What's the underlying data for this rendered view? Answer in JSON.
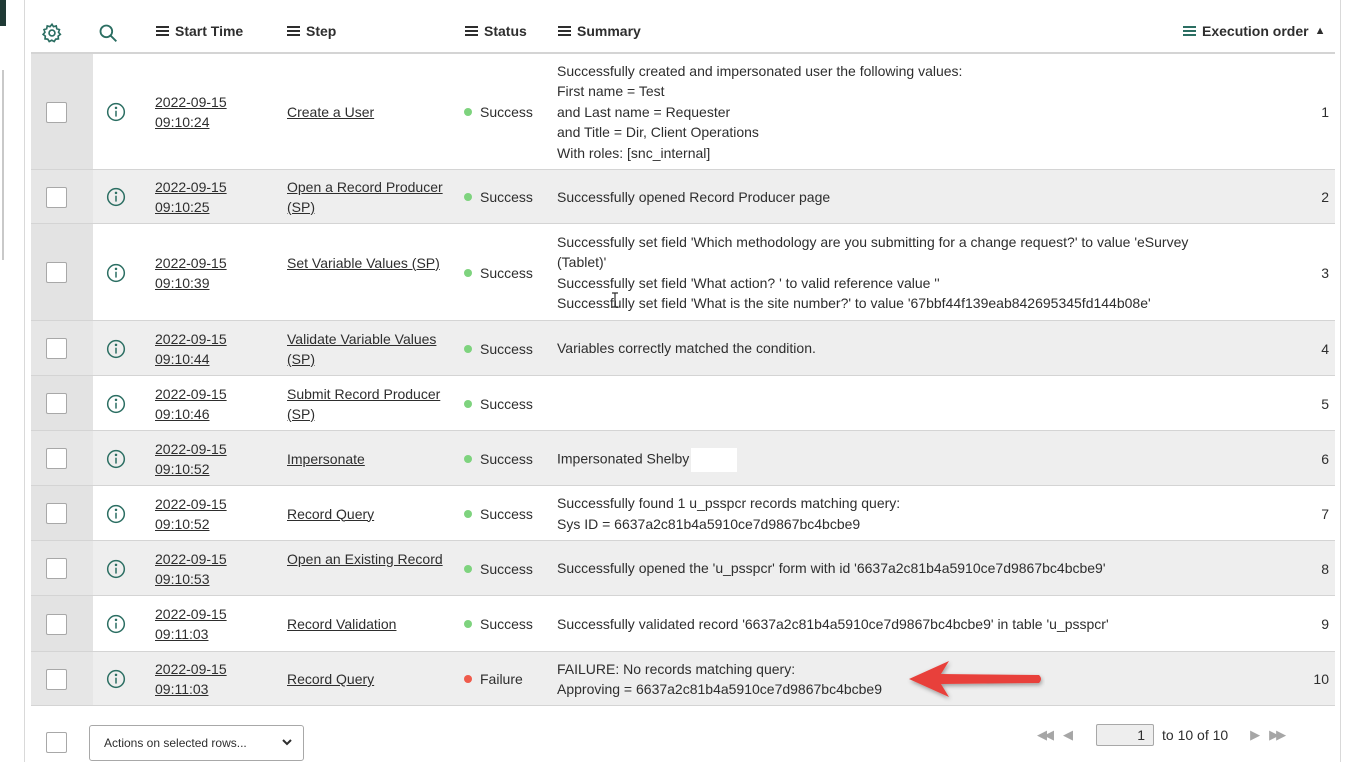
{
  "header": {
    "start_time": "Start Time",
    "step": "Step",
    "status": "Status",
    "summary": "Summary",
    "execution_order": "Execution order",
    "sort_indicator": "▲"
  },
  "icons": {
    "settings": "gear-icon",
    "search": "search-icon",
    "column_menu": "hamburger-icon",
    "row_info": "info-icon",
    "annotation": "red-arrow"
  },
  "colors": {
    "accent": "#2b6e62",
    "success": "#7ed37e",
    "failure": "#ef5b4b",
    "arrow": "#e8413a"
  },
  "rows": [
    {
      "date": "2022-09-15",
      "time": "09:10:24",
      "step": "Create a User",
      "status": "Success",
      "status_type": "ok",
      "summary": [
        "Successfully created and impersonated user the following values:",
        "First name = Test",
        "and Last name = Requester",
        "and Title = Dir, Client Operations",
        "With roles: [snc_internal]"
      ],
      "order": "1"
    },
    {
      "date": "2022-09-15",
      "time": "09:10:25",
      "step": "Open a Record Producer (SP)",
      "status": "Success",
      "status_type": "ok",
      "summary": [
        "Successfully opened Record Producer page"
      ],
      "order": "2"
    },
    {
      "date": "2022-09-15",
      "time": "09:10:39",
      "step": "Set Variable Values (SP)",
      "status": "Success",
      "status_type": "ok",
      "summary": [
        "Successfully set field 'Which methodology are you submitting for a change request?' to value 'eSurvey (Tablet)'",
        "Successfully set field 'What action? ' to valid reference value ''",
        "Successfully set field 'What is the site number?' to value '67bbf44f139eab842695345fd144b08e'"
      ],
      "order": "3"
    },
    {
      "date": "2022-09-15",
      "time": "09:10:44",
      "step": "Validate Variable Values (SP)",
      "status": "Success",
      "status_type": "ok",
      "summary": [
        "Variables correctly matched the condition."
      ],
      "order": "4"
    },
    {
      "date": "2022-09-15",
      "time": "09:10:46",
      "step": "Submit Record Producer (SP)",
      "status": "Success",
      "status_type": "ok",
      "summary": [],
      "order": "5"
    },
    {
      "date": "2022-09-15",
      "time": "09:10:52",
      "step": "Impersonate",
      "status": "Success",
      "status_type": "ok",
      "summary": [
        "Impersonated Shelby"
      ],
      "order": "6"
    },
    {
      "date": "2022-09-15",
      "time": "09:10:52",
      "step": "Record Query",
      "status": "Success",
      "status_type": "ok",
      "summary": [
        "Successfully found 1 u_psspcr records matching query:",
        "Sys ID = 6637a2c81b4a5910ce7d9867bc4bcbe9"
      ],
      "order": "7"
    },
    {
      "date": "2022-09-15",
      "time": "09:10:53",
      "step": "Open an Existing Record",
      "status": "Success",
      "status_type": "ok",
      "summary": [
        "Successfully opened the 'u_psspcr' form with id '6637a2c81b4a5910ce7d9867bc4bcbe9'"
      ],
      "order": "8"
    },
    {
      "date": "2022-09-15",
      "time": "09:11:03",
      "step": "Record Validation",
      "status": "Success",
      "status_type": "ok",
      "summary": [
        "Successfully validated record '6637a2c81b4a5910ce7d9867bc4bcbe9' in table 'u_psspcr'"
      ],
      "order": "9"
    },
    {
      "date": "2022-09-15",
      "time": "09:11:03",
      "step": "Record Query",
      "status": "Failure",
      "status_type": "fail",
      "summary": [
        "FAILURE: No records matching query:",
        "Approving = 6637a2c81b4a5910ce7d9867bc4bcbe9"
      ],
      "order": "10"
    }
  ],
  "footer": {
    "actions_label": "Actions on selected rows...",
    "page_value": "1",
    "page_range": "to 10 of 10"
  }
}
